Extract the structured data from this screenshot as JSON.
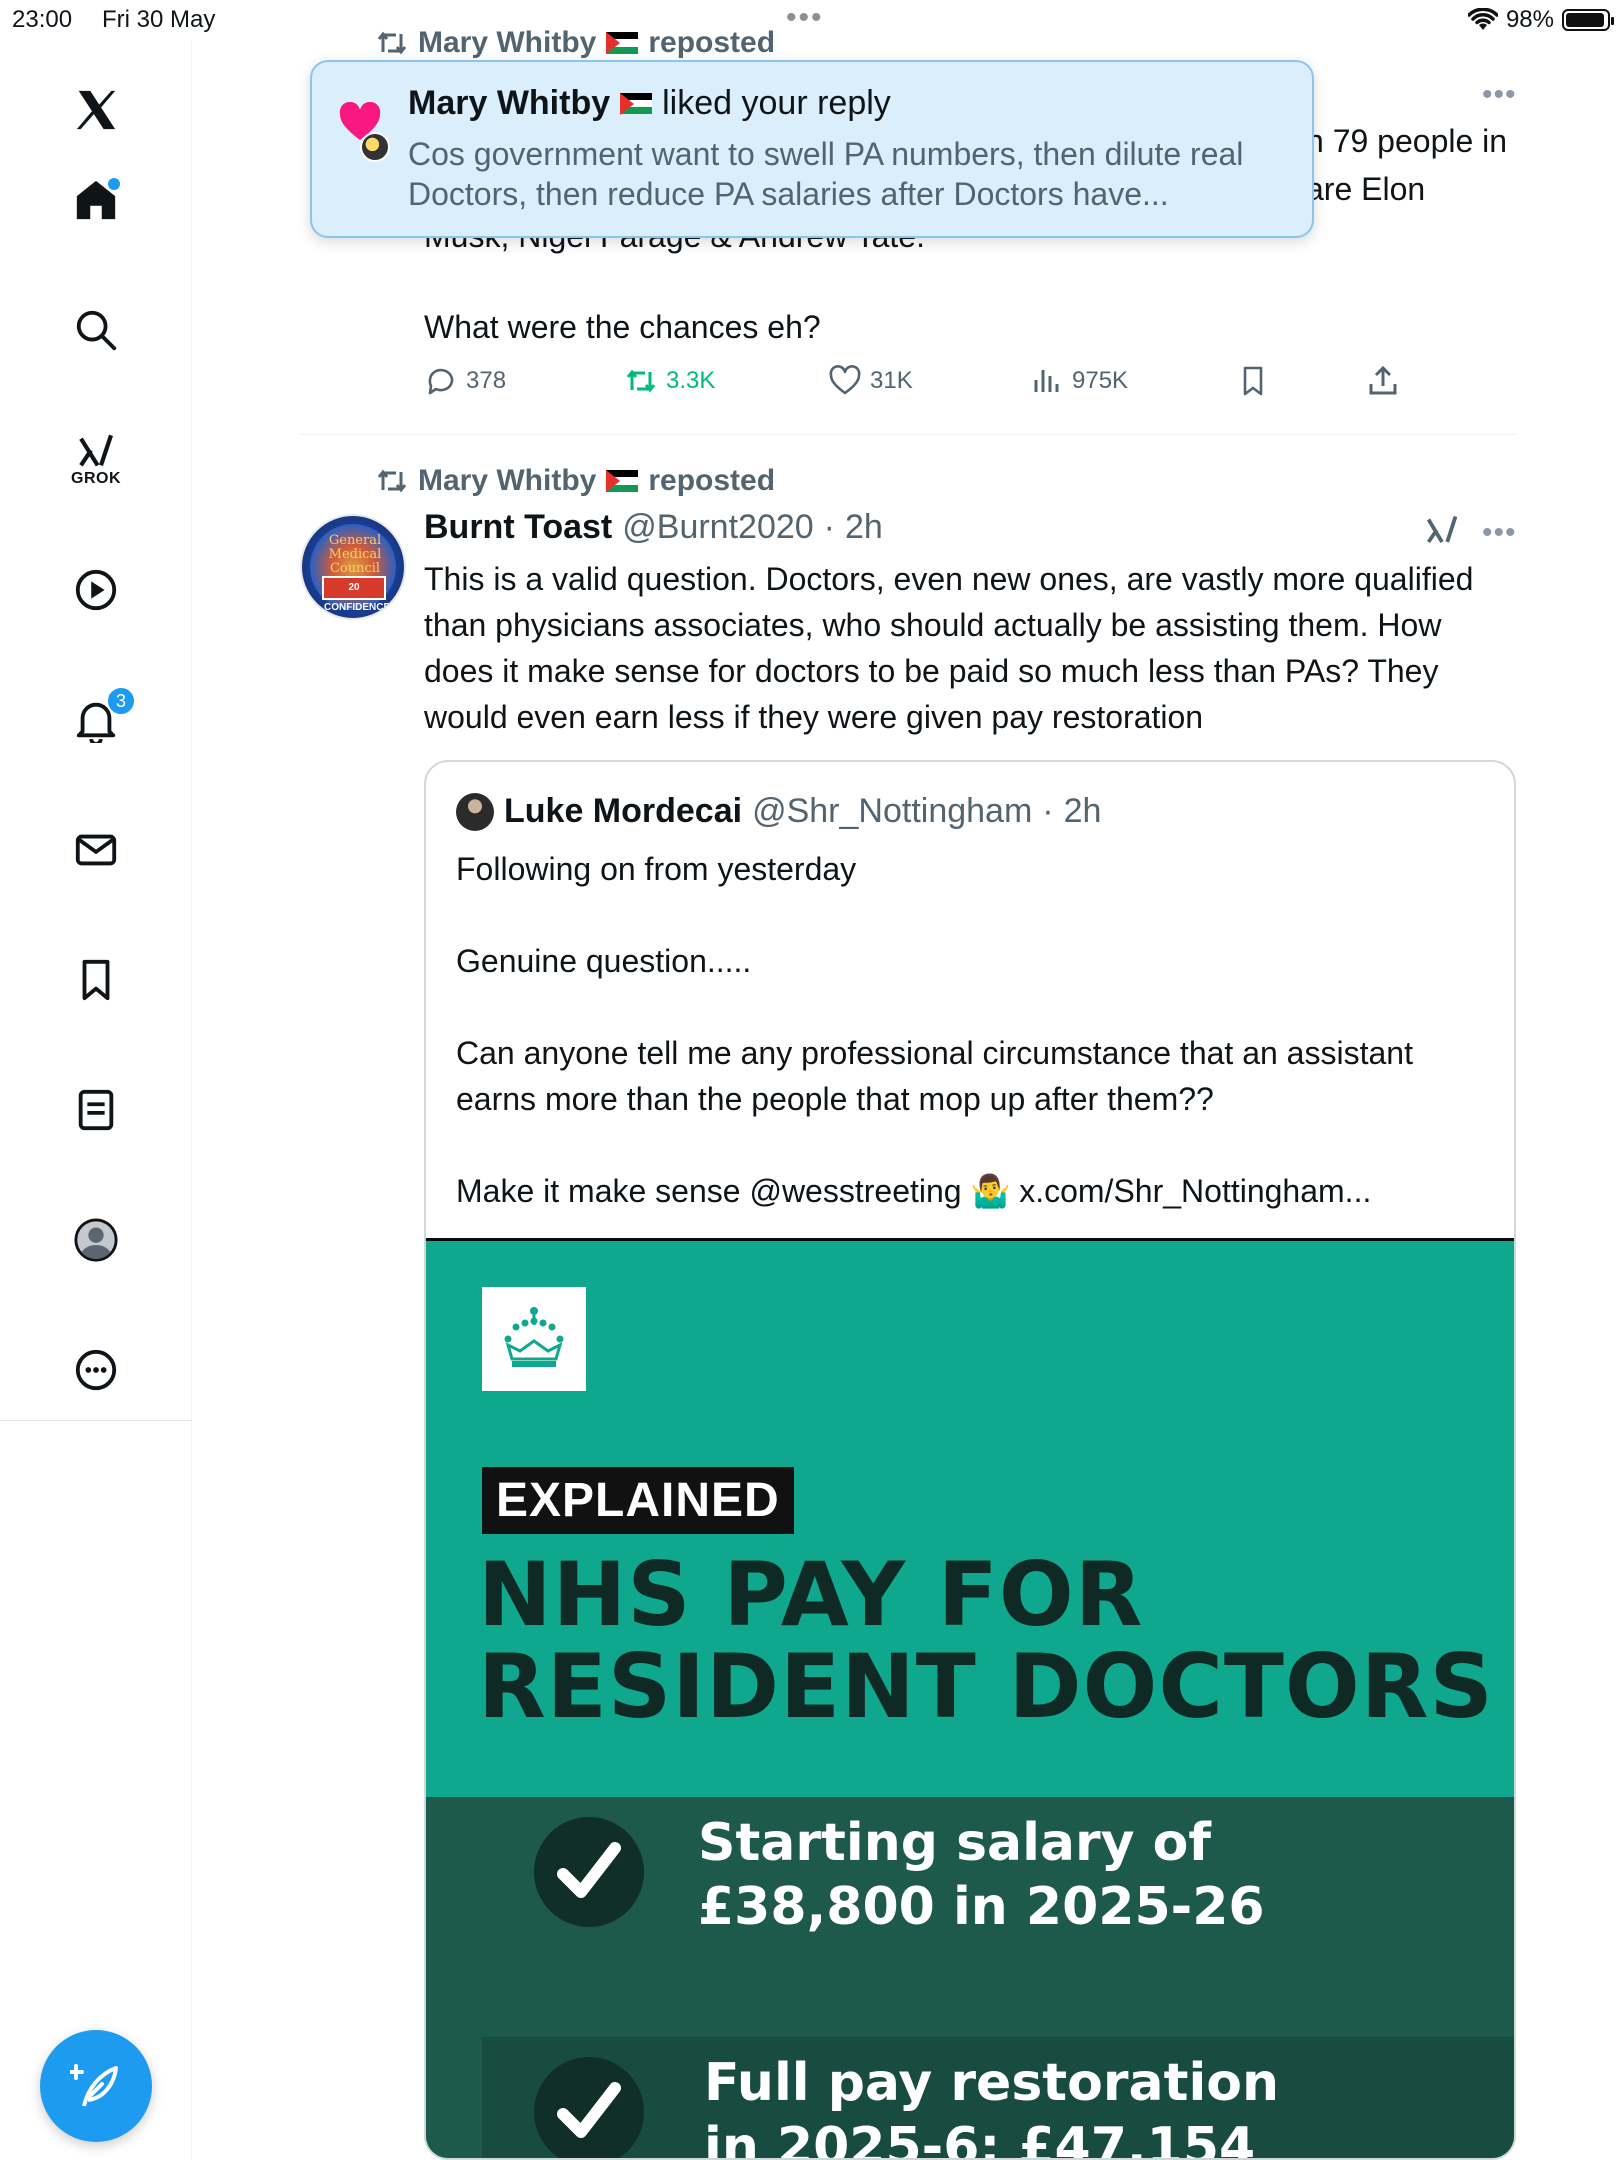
{
  "status_bar": {
    "time": "23:00",
    "date": "Fri 30 May",
    "dots": "•••",
    "battery": "98%"
  },
  "sidebar": {
    "grok_label": "GROK",
    "notifications_badge": "3"
  },
  "top_tweet": {
    "repost_user": "Mary Whitby",
    "repost_label": "reposted",
    "partial_line_1": "n 79 people in",
    "partial_line_2": "are Elon",
    "partial_hidden_line": "Musk, Nigel Farage & Andrew Tate.",
    "text": "What were the chances eh?",
    "replies": "378",
    "reposts": "3.3K",
    "likes": "31K",
    "views": "975K"
  },
  "notification": {
    "user": "Mary Whitby",
    "action": "liked your reply",
    "body": "Cos government want to swell PA numbers, then dilute real Doctors, then reduce PA salaries after Doctors have..."
  },
  "tweet": {
    "repost_user": "Mary Whitby",
    "repost_label": "reposted",
    "author_name": "Burnt Toast",
    "author_handle": "@Burnt2020",
    "dot": "·",
    "time": "2h",
    "text": "This is a valid question. Doctors, even new ones, are vastly more qualified than physicians associates, who should actually be assisting them. How does it make sense for doctors to be paid so much less than PAs? They would even earn less if they were given pay restoration",
    "avatar_text_1": "General Medical Council",
    "avatar_text_2": "20 CONFIDENCE"
  },
  "quote": {
    "author_name": "Luke Mordecai",
    "author_handle": "@Shr_Nottingham",
    "dot": "·",
    "time": "2h",
    "line_1": "Following on from yesterday",
    "line_2": "Genuine question.....",
    "line_3": "Can anyone tell me any professional circumstance that an assistant earns more than the people that mop up after them??",
    "line_4": "Make it make sense @wesstreeting 🤷‍♂️ x.com/Shr_Nottingham..."
  },
  "image": {
    "tag": "EXPLAINED",
    "headline_1": "NHS PAY FOR",
    "headline_2": "RESIDENT DOCTORS",
    "point_1_line_1": "Starting salary of",
    "point_1_line_2": "£38,800 in 2025-26",
    "point_2_line_1": "Full pay restoration",
    "point_2_line_2": "in 2025-6: £47,154"
  },
  "colors": {
    "accent": "#1d9bf0",
    "repost_green": "#00ba7c",
    "muted": "#536471",
    "nhs_teal": "#0fa88e",
    "nhs_dark": "#1d5a4c"
  },
  "icons": [
    "x-logo-icon",
    "home-icon",
    "search-icon",
    "grok-icon",
    "video-icon",
    "bell-icon",
    "mail-icon",
    "bookmark-icon",
    "lists-icon",
    "profile-icon",
    "more-icon",
    "compose-icon",
    "reply-icon",
    "repost-icon",
    "like-icon",
    "views-icon",
    "share-icon",
    "heart-icon",
    "check-icon",
    "crest-icon"
  ]
}
